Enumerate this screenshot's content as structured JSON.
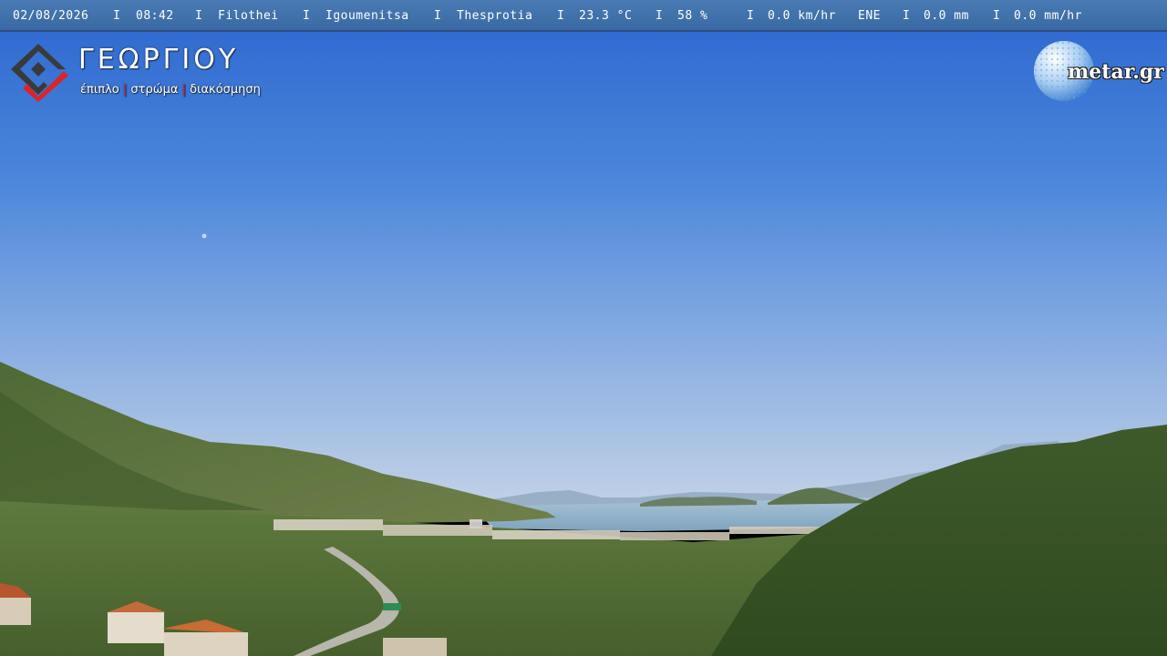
{
  "status": {
    "date": "02/08/2026",
    "time": "08:42",
    "area": "Filothei",
    "town": "Igoumenitsa",
    "region": "Thesprotia",
    "temperature": "23.3 °C",
    "humidity": "58 %",
    "wind_speed": "0.0 km/hr",
    "wind_direction": "ENE",
    "rain": "0.0 mm",
    "rain_rate": "0.0 mm/hr",
    "separator": "I"
  },
  "brand": {
    "name": "ΓΕΩΡΓΙΟΥ",
    "tagline_1": "έπιπλο",
    "tagline_2": "στρώμα",
    "tagline_3": "διακόσμηση",
    "tagline_bar": "|",
    "logo_icon": "diamond-check-icon",
    "colors": {
      "dark": "#3a3a3a",
      "accent": "#d7262b"
    }
  },
  "watermark": {
    "text": "metar.gr",
    "icon": "golf-ball-globe-icon"
  },
  "colors": {
    "status_bar": "#3f6fab",
    "sky_top": "#2f6cd6",
    "sky_horizon": "#b9cfe6",
    "sea": "#8fb2cc",
    "hills": "#4d6a32"
  }
}
